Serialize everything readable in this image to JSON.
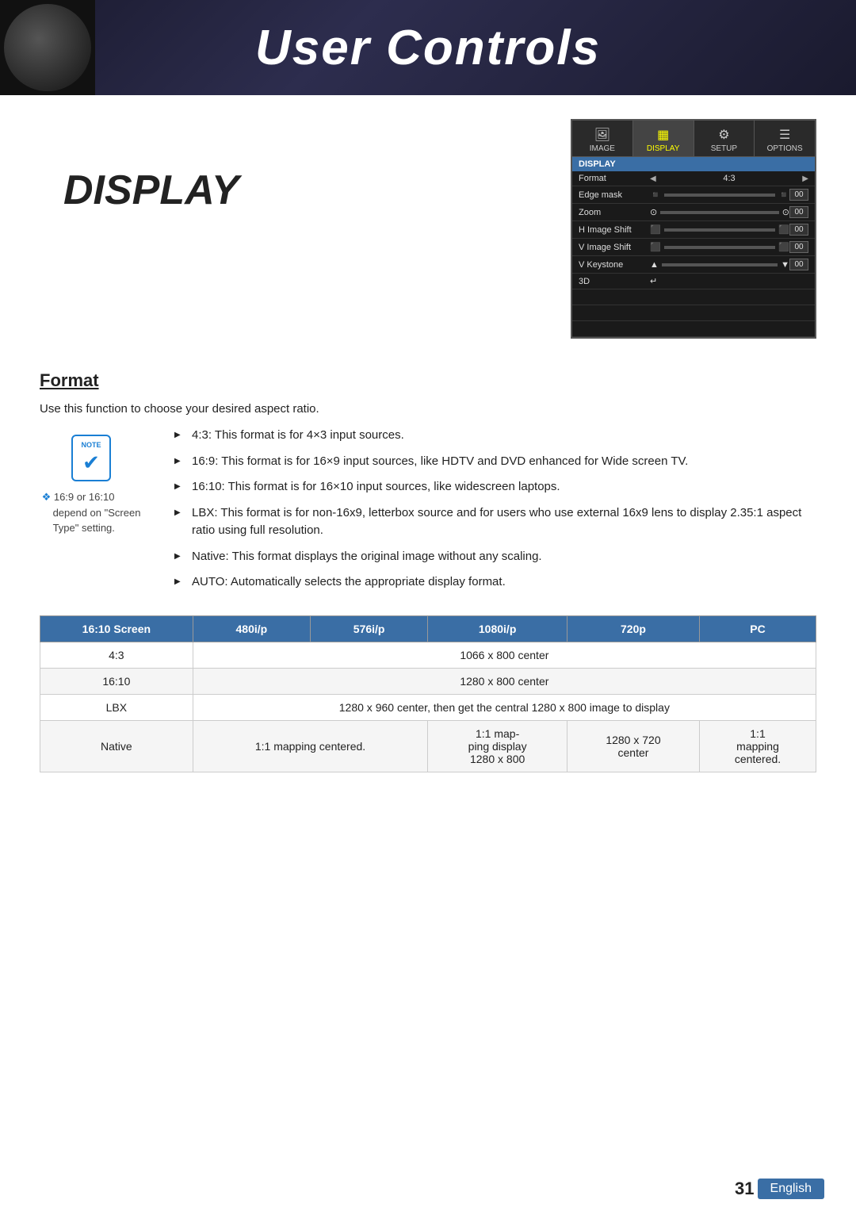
{
  "header": {
    "title": "User Controls"
  },
  "display_heading": "DISPLAY",
  "osd": {
    "tabs": [
      {
        "label": "IMAGE",
        "icon": "🖼",
        "active": false
      },
      {
        "label": "DISPLAY",
        "icon": "▦",
        "active": true
      },
      {
        "label": "SETUP",
        "icon": "🔧",
        "active": false
      },
      {
        "label": "OPTIONS",
        "icon": "☰",
        "active": false
      }
    ],
    "section_title": "DISPLAY",
    "rows": [
      {
        "label": "Format",
        "type": "format",
        "value": "4:3"
      },
      {
        "label": "Edge mask",
        "type": "slider",
        "value": "00"
      },
      {
        "label": "Zoom",
        "type": "slider",
        "value": "00"
      },
      {
        "label": "H Image Shift",
        "type": "slider",
        "value": "00"
      },
      {
        "label": "V Image Shift",
        "type": "slider",
        "value": "00"
      },
      {
        "label": "V Keystone",
        "type": "slider",
        "value": "00"
      },
      {
        "label": "3D",
        "type": "enter"
      }
    ]
  },
  "format_section": {
    "heading": "Format",
    "intro": "Use this function to choose your desired aspect ratio.",
    "bullets": [
      "4:3: This format is for 4×3 input sources.",
      "16:9: This format is for 16×9 input sources, like HDTV and DVD enhanced for Wide screen TV.",
      "16:10: This format is for 16×10 input sources, like widescreen laptops.",
      "LBX: This format is for non-16x9, letterbox source and for users who use external 16x9 lens to display 2.35:1 aspect ratio using full resolution.",
      "Native: This format displays the original image without any scaling.",
      "AUTO: Automatically selects the appropriate display format."
    ]
  },
  "note": {
    "tag": "NOTE",
    "lines": [
      "❖  16:9 or 16:10",
      "     depend on \"Screen",
      "     Type\" setting."
    ]
  },
  "table": {
    "headers": [
      "16:10 Screen",
      "480i/p",
      "576i/p",
      "1080i/p",
      "720p",
      "PC"
    ],
    "rows": [
      {
        "label": "4:3",
        "cells": [
          "1066 x 800 center",
          "",
          "",
          "",
          ""
        ]
      },
      {
        "label": "16:10",
        "cells": [
          "1280 x 800 center",
          "",
          "",
          "",
          ""
        ]
      },
      {
        "label": "LBX",
        "cells": [
          "1280 x 960 center, then get the central 1280 x 800 image to display",
          "",
          "",
          "",
          ""
        ]
      },
      {
        "label": "Native",
        "cells": [
          "1:1 mapping centered.",
          "1:1 map-\nping display\n1280 x 800",
          "1280 x 720\ncenter",
          "1:1\nmapping\ncentered."
        ]
      }
    ]
  },
  "footer": {
    "page_number": "31",
    "language": "English"
  }
}
